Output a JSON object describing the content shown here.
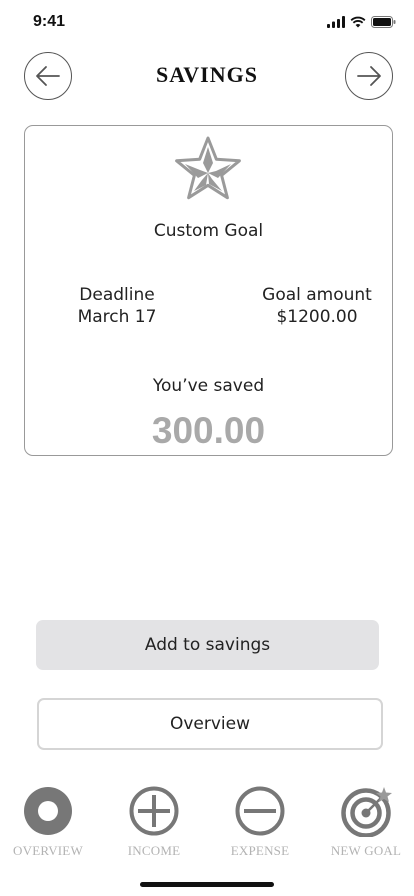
{
  "status_bar": {
    "time": "9:41"
  },
  "header": {
    "title": "SAVINGS"
  },
  "goal": {
    "name": "Custom Goal",
    "deadline_label": "Deadline",
    "deadline_value": "March 17",
    "amount_label": "Goal amount",
    "amount_value": "$1200.00",
    "saved_label": "You’ve saved",
    "saved_value": "300.00"
  },
  "actions": {
    "add_label": "Add to savings",
    "overview_label": "Overview"
  },
  "tabs": [
    {
      "label": "OVERVIEW",
      "icon": "filled-circle-icon"
    },
    {
      "label": "INCOME",
      "icon": "plus-circle-icon"
    },
    {
      "label": "EXPENSE",
      "icon": "minus-circle-icon"
    },
    {
      "label": "NEW GOAL",
      "icon": "target-icon"
    }
  ],
  "colors": {
    "tab_icon": "#777777",
    "tab_label": "#b3b3b3",
    "saved_amount": "#a9a9a9",
    "primary_button": "#e3e3e5"
  }
}
